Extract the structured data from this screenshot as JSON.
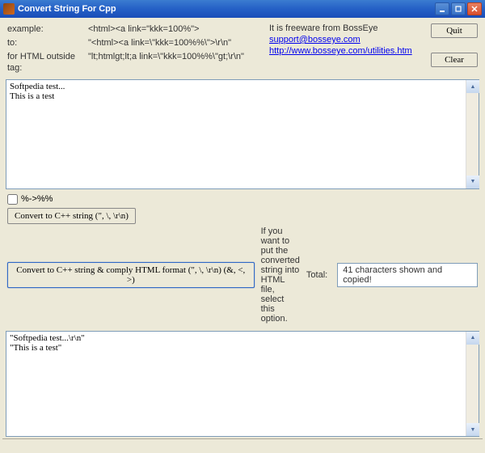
{
  "titlebar": {
    "title": "Convert String For Cpp"
  },
  "examples": {
    "example_label": "example:",
    "example_value": "<html><a link=\"kkk=100%\">",
    "to_label": "to:",
    "to_value": "\"<html><a link=\\\"kkk=100%%\\\">\\r\\n\"",
    "html_label": "for HTML outside tag:",
    "html_value": "\"lt;htmlgt;lt;a link=\\\"kkk=100%%\\\"gt;\\r\\n\""
  },
  "about": {
    "freeware": "It is freeware from BossEye",
    "email": "support@bosseye.com",
    "url": "http://www.bosseye.com/utilities.htm"
  },
  "buttons": {
    "quit": "Quit",
    "clear": "Clear",
    "convert1": "Convert to C++ string (\", \\, \\r\\n)",
    "convert2": "Convert to C++ string & comply HTML format (\", \\, \\r\\n) (&, <, >)"
  },
  "checkbox": {
    "label": "%->%%"
  },
  "hint": "If you want to put the converted string into HTML file, select this option.",
  "total": {
    "label": "Total:",
    "value": "41 characters shown and copied!"
  },
  "input_text": "Softpedia test...\nThis is a test",
  "output_text": "\"Softpedia test...\\r\\n\"\n\"This is a test\""
}
